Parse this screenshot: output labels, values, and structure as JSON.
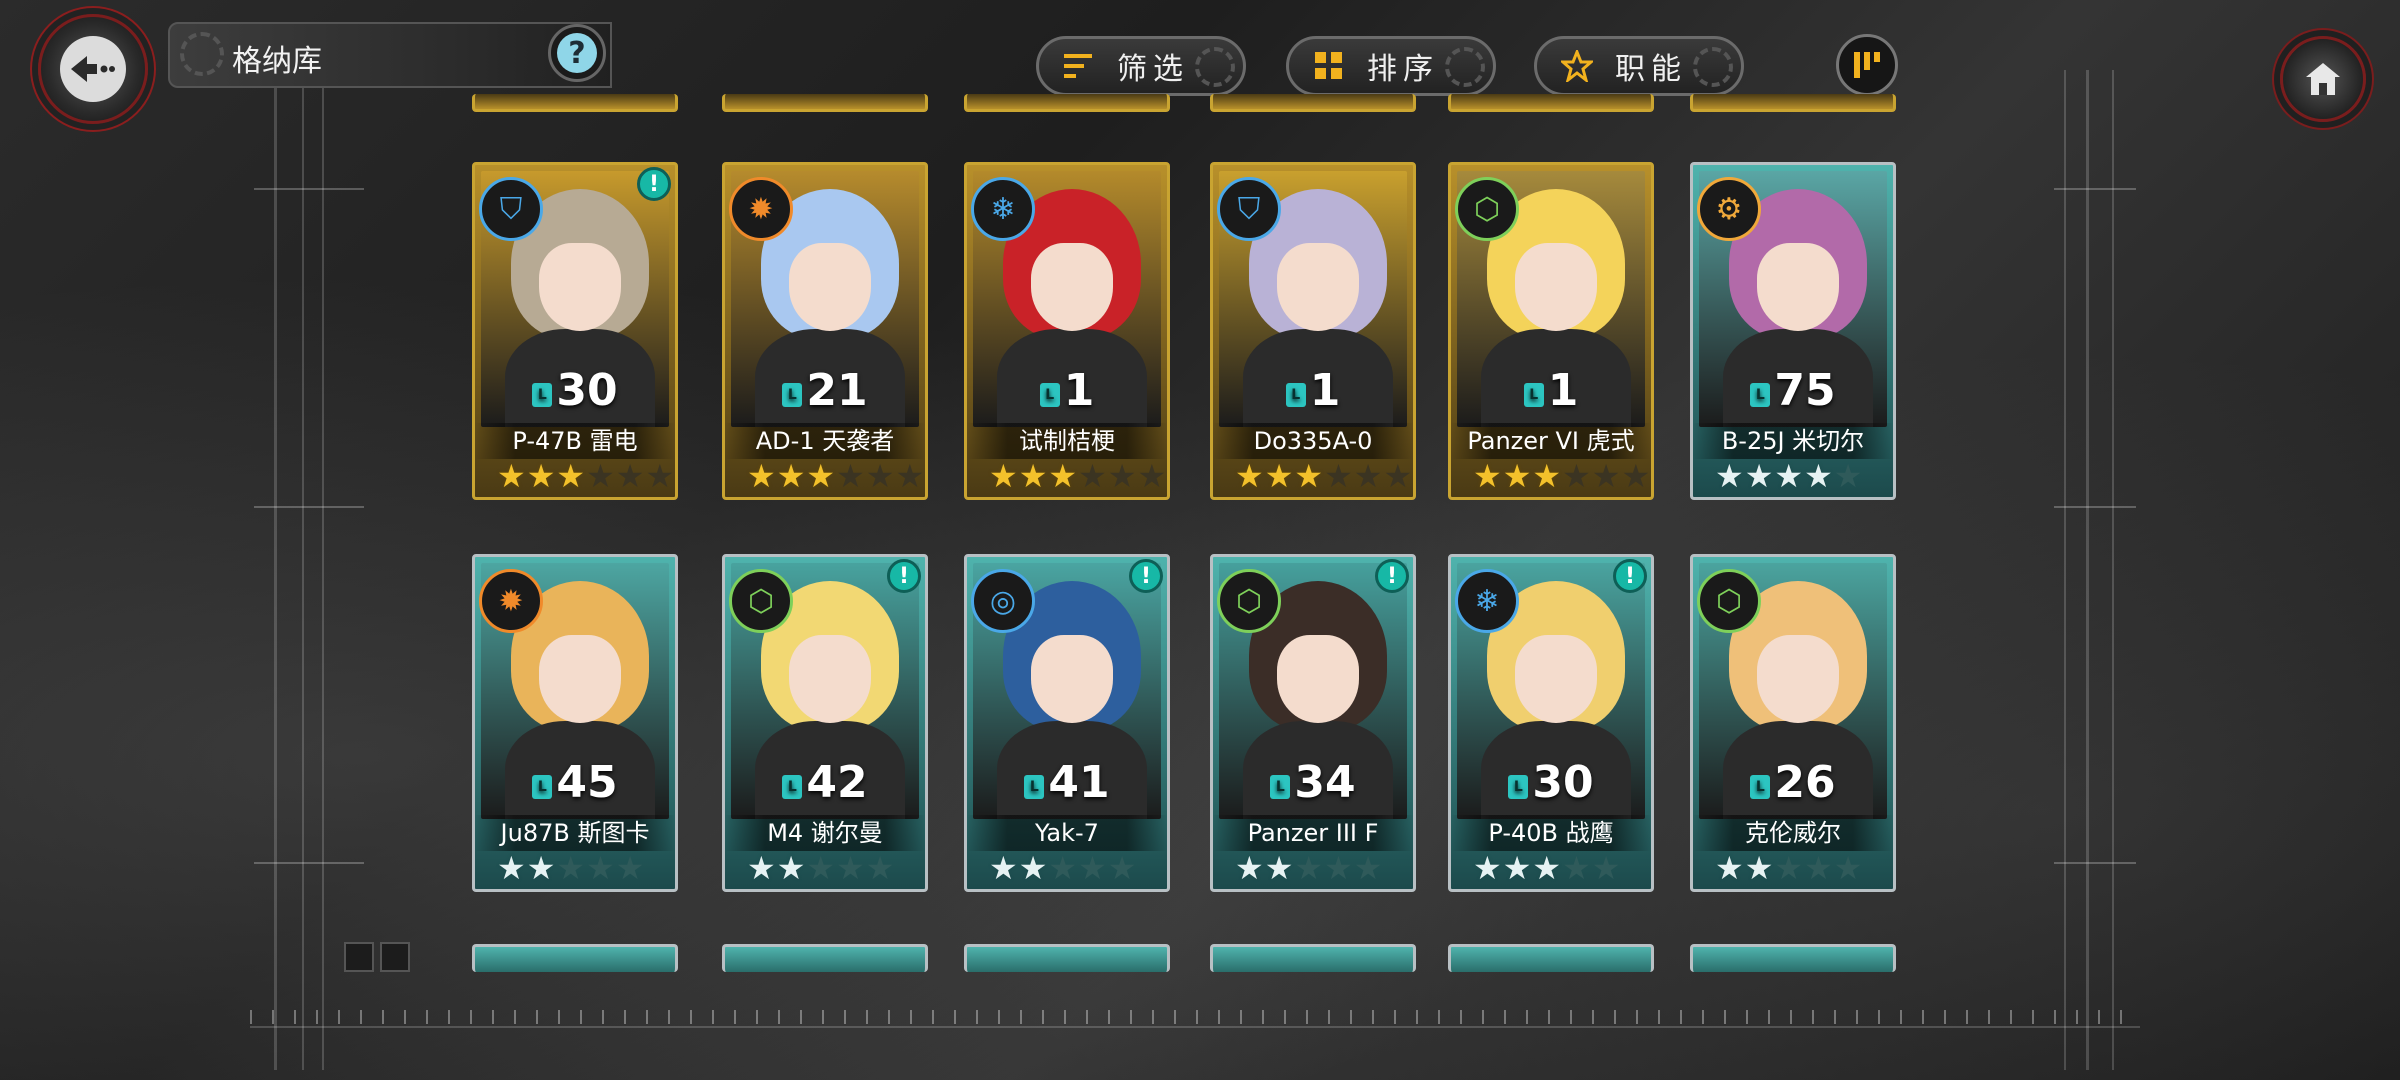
{
  "header": {
    "title": "格纳库",
    "help_label": "?",
    "filter_label": "筛选",
    "sort_label": "排序",
    "role_label": "职能"
  },
  "icons": {
    "back": "back-arrow-icon",
    "help": "question-icon",
    "filter": "filter-lines-icon",
    "sort": "grid-squares-icon",
    "role": "star-outline-icon",
    "sort_order": "descending-bars-icon",
    "home": "home-icon"
  },
  "colors": {
    "gold_frame": "#c9a431",
    "teal_frame": "#4fb3ad",
    "alert": "#17b8a6",
    "level_tag": "#2cc5c1",
    "accent_red": "#8b1e1e"
  },
  "level_tag_label": "LV",
  "alert_label": "!",
  "units": [
    {
      "name": "P-47B 雷电",
      "level": "30",
      "rarity": "gold",
      "stars": 3,
      "max_stars": 6,
      "alert": true,
      "role_icon": "shield-wing-icon",
      "hair": "#b7aa94",
      "bg": "#c79a2c"
    },
    {
      "name": "AD-1 天袭者",
      "level": "21",
      "rarity": "gold",
      "stars": 3,
      "max_stars": 6,
      "alert": false,
      "role_icon": "flame-icon",
      "hair": "#a9c8f0",
      "bg": "#b68b2d"
    },
    {
      "name": "试制桔梗",
      "level": "1",
      "rarity": "gold",
      "stars": 3,
      "max_stars": 6,
      "alert": false,
      "role_icon": "snowflake-icon",
      "hair": "#c92228",
      "bg": "#b48a2b"
    },
    {
      "name": "Do335A-0",
      "level": "1",
      "rarity": "gold",
      "stars": 3,
      "max_stars": 6,
      "alert": false,
      "role_icon": "shield-wing-icon",
      "hair": "#b9b2d6",
      "bg": "#c9a02e"
    },
    {
      "name": "Panzer VI 虎式",
      "level": "1",
      "rarity": "gold",
      "stars": 3,
      "max_stars": 6,
      "alert": false,
      "role_icon": "leaf-icon",
      "hair": "#f4d35a",
      "bg": "#a68a3c"
    },
    {
      "name": "B-25J 米切尔",
      "level": "75",
      "rarity": "teal",
      "stars": 4,
      "max_stars": 5,
      "alert": false,
      "role_icon": "support-icon",
      "hair": "#b26aa9",
      "bg": "#5aa6a5"
    },
    {
      "name": "Ju87B 斯图卡",
      "level": "45",
      "rarity": "teal",
      "stars": 2,
      "max_stars": 5,
      "alert": false,
      "role_icon": "flame-icon",
      "hair": "#e9b45a",
      "bg": "#4da6a2"
    },
    {
      "name": "M4 谢尔曼",
      "level": "42",
      "rarity": "teal",
      "stars": 2,
      "max_stars": 5,
      "alert": true,
      "role_icon": "leaf-icon",
      "hair": "#f2d873",
      "bg": "#48a39f"
    },
    {
      "name": "Yak-7",
      "level": "41",
      "rarity": "teal",
      "stars": 2,
      "max_stars": 5,
      "alert": true,
      "role_icon": "target-icon",
      "hair": "#2d5f9e",
      "bg": "#4aa5a2"
    },
    {
      "name": "Panzer III F",
      "level": "34",
      "rarity": "teal",
      "stars": 2,
      "max_stars": 5,
      "alert": true,
      "role_icon": "leaf-icon",
      "hair": "#3b2d27",
      "bg": "#46a09d"
    },
    {
      "name": "P-40B 战鹰",
      "level": "30",
      "rarity": "teal",
      "stars": 3,
      "max_stars": 5,
      "alert": true,
      "role_icon": "snowflake-icon",
      "hair": "#f0cf6e",
      "bg": "#4aa4a0"
    },
    {
      "name": "克伦威尔",
      "level": "26",
      "rarity": "teal",
      "stars": 2,
      "max_stars": 5,
      "alert": false,
      "role_icon": "leaf-icon",
      "hair": "#efc079",
      "bg": "#4ba49f"
    }
  ]
}
